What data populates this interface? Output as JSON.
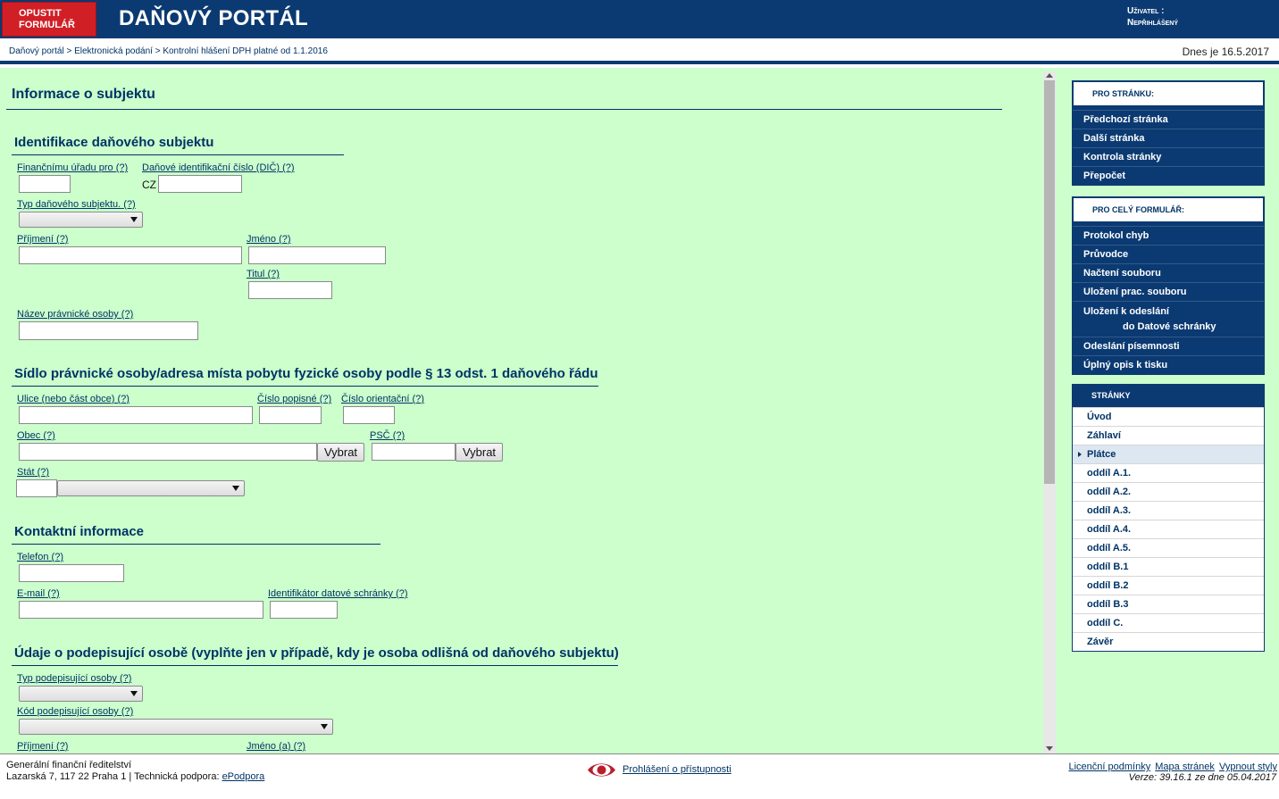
{
  "header": {
    "exit_button_line1": "OPUSTIT",
    "exit_button_line2": "FORMULÁŘ",
    "portal_title": "DAŇOVÝ PORTÁL",
    "user_label": "Uživatel :",
    "user_value": "Nepřihlášený"
  },
  "breadcrumb": "Daňový portál > Elektronická podání > Kontrolní hlášení DPH platné od 1.1.2016",
  "today": "Dnes je 16.5.2017",
  "form": {
    "page_title": "Informace o subjektu",
    "section_identification": "Identifikace daňového subjektu",
    "financni_urad_label": "Finančnímu úřadu pro",
    "help": "(?)",
    "dic_label": "Daňové identifikační číslo (DIČ)",
    "dic_prefix": "CZ",
    "typ_subjektu_label": "Typ daňového subjektu.",
    "prijmeni_label": "Příjmení",
    "jmeno_label": "Jméno",
    "titul_label": "Titul",
    "nazev_pravnicke_label": "Název právnické osoby",
    "section_address": "Sídlo právnické osoby/adresa místa pobytu fyzické osoby podle § 13 odst. 1 daňového řádu",
    "ulice_label": "Ulice (nebo část obce)",
    "cislo_popisne_label": "Číslo popisné",
    "cislo_orientacni_label": "Číslo orientační",
    "obec_label": "Obec",
    "psc_label": "PSČ",
    "vybrat_label": "Vybrat",
    "stat_label": "Stát",
    "section_contact": "Kontaktní informace",
    "telefon_label": "Telefon",
    "email_label": "E-mail",
    "datova_schranka_label": "Identifikátor datové schránky",
    "section_signer": "Údaje o podepisující osobě (vyplňte jen v případě, kdy je osoba odlišná od daňového subjektu)",
    "typ_podepisujici_label": "Typ podepisující osoby",
    "kod_podepisujici_label": "Kód podepisující osoby",
    "prijmeni2_label": "Příjmení",
    "jmeno2_label": "Jméno (a)"
  },
  "sidebar": {
    "page_panel_title": "Pro stránku:",
    "page_items": [
      "Předchozí stránka",
      "Další stránka",
      "Kontrola stránky",
      "Přepočet"
    ],
    "form_panel_title": "Pro celý formulář:",
    "form_items": [
      "Protokol chyb",
      "Průvodce",
      "Načtení souboru",
      "Uložení prac. souboru"
    ],
    "form_item_databox_line1": "Uložení k odeslání",
    "form_item_databox_line2": "do Datové schránky",
    "form_items_after": [
      "Odeslání písemnosti",
      "Úplný opis k tisku"
    ],
    "pages_title": "Stránky",
    "pages": [
      "Úvod",
      "Záhlaví",
      "Plátce",
      "oddíl A.1.",
      "oddíl A.2.",
      "oddíl A.3.",
      "oddíl A.4.",
      "oddíl A.5.",
      "oddíl B.1",
      "oddíl B.2",
      "oddíl B.3",
      "oddíl C.",
      "Závěr"
    ],
    "active_page": "Plátce"
  },
  "footer": {
    "org": "Generální finanční ředitelství",
    "address_prefix": "Lazarská 7, 117 22 Praha 1 | Technická podpora: ",
    "support_link": "ePodpora",
    "accessibility": "Prohlášení o přístupnosti",
    "links": [
      "Licenční podmínky",
      "Mapa stránek",
      "Vypnout styly"
    ],
    "version": "Verze: 39.16.1 ze dne 05.04.2017"
  },
  "colors": {
    "navy": "#0b3a72",
    "exit_red": "#d11f26",
    "form_bg": "#ccffcc",
    "link": "#003366"
  }
}
